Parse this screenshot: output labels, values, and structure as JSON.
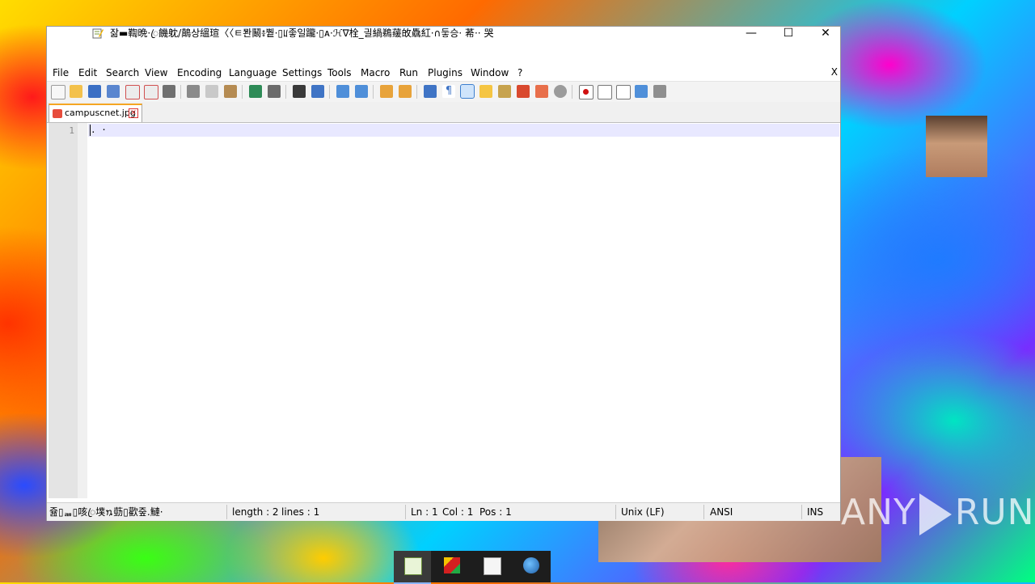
{
  "window": {
    "title": "잚▬鞫晩·ꦿ饑躭/鷏상縕瑄〈〈ㅌ̀콴鬫៖쀁·▯ꡊ좋일躘·▯ᴀ·ℋ∇栓_긜緺鵜藧敀驫紅·∩둫승· 莃·· 哭",
    "minimize": "—",
    "maximize": "☐",
    "close": "✕"
  },
  "menu": {
    "items": [
      "File",
      "Edit",
      "Search",
      "View",
      "Encoding",
      "Language",
      "Settings",
      "Tools",
      "Macro",
      "Run",
      "Plugins",
      "Window",
      "?"
    ],
    "close_doc": "X"
  },
  "tab": {
    "label": "campuscnet.jpg",
    "close": "✕"
  },
  "editor": {
    "line_numbers": [
      "1"
    ],
    "lines": [
      ". ·"
    ]
  },
  "status": {
    "left_text": "쥺▯ᇔ▯咳ꦿ墣ꪧ葝▯歡줖.鰱·",
    "length": "length : 2",
    "lines": "lines : 1",
    "ln": "Ln : 1",
    "col": "Col : 1",
    "pos": "Pos : 1",
    "eol": "Unix (LF)",
    "encoding": "ANSI",
    "mode": "INS"
  },
  "watermark": {
    "left": "ANY",
    "right": "RUN"
  },
  "colors": {
    "tab_accent": "#f5a623",
    "current_line": "#e8e8ff",
    "taskbar": "#1d1d1d"
  }
}
